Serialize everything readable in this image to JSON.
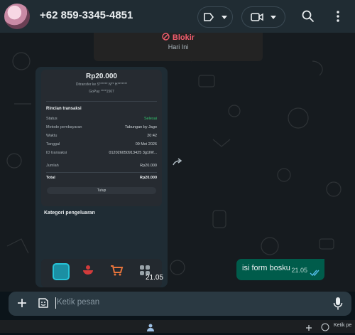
{
  "header": {
    "contact_name": "+62 859-3345-4851",
    "icons": [
      "label-icon",
      "chevron-down-icon",
      "video-call-icon",
      "chevron-down-icon",
      "search-icon",
      "more-vert-icon"
    ]
  },
  "system_card": {
    "blokir_label": "Blokir",
    "date_label": "Hari Ini"
  },
  "image_message": {
    "time": "21.05",
    "receipt": {
      "amount": "Rp20.000",
      "transfer_line": "Ditransfer ke S****** N** H*******",
      "gopay_line": "GoPay ****1567",
      "section_title": "Rincian transaksi",
      "rows": [
        {
          "key": "Status",
          "value": "Selesai"
        },
        {
          "key": "Metode pembayaran",
          "value": "Tabungan by Jago"
        },
        {
          "key": "Waktu",
          "value": "20:42"
        },
        {
          "key": "Tanggal",
          "value": "09 Mei 2026"
        },
        {
          "key": "ID transaksi",
          "value": "012026050913425 3g1IW..."
        }
      ],
      "jumlah_label": "Jumlah",
      "jumlah_value": "Rp20.000",
      "total_label": "Total",
      "total_value": "Rp20.000",
      "tutup_label": "Tutup",
      "kategori_title": "Kategori pengeluaran"
    }
  },
  "outgoing_message": {
    "text": "isi form bosku",
    "time": "21.05"
  },
  "composer": {
    "placeholder": "Ketik pesan"
  },
  "taskbar": {
    "text": "Ketik pe"
  },
  "colors": {
    "outgoing_bubble": "#005c4b",
    "header_bg": "#202c33",
    "status_green": "#33c26d",
    "blokir_red": "#f15c6d"
  }
}
